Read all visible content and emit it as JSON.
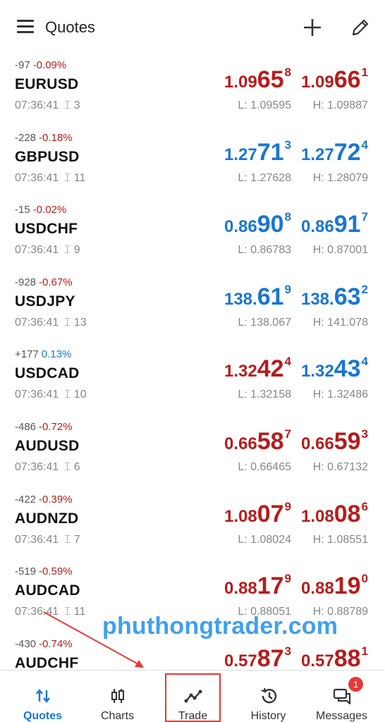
{
  "header": {
    "title": "Quotes",
    "menu_icon": "menu-icon",
    "add_icon": "plus-icon",
    "edit_icon": "pencil-icon"
  },
  "colors": {
    "down": "#b71c1c",
    "up": "#1976d2",
    "watermark": "#3fa0ef",
    "badge": "#e53935"
  },
  "quotes": [
    {
      "symbol": "EURUSD",
      "change_pts": "-97",
      "change_pct": "-0.09%",
      "change_dir": "neg",
      "time": "07:36:41",
      "spread": "3",
      "bid": {
        "small": "1.09",
        "big": "65",
        "sup": "8",
        "dir": "down"
      },
      "ask": {
        "small": "1.09",
        "big": "66",
        "sup": "1",
        "dir": "down"
      },
      "low": "L: 1.09595",
      "high": "H: 1.09887"
    },
    {
      "symbol": "GBPUSD",
      "change_pts": "-228",
      "change_pct": "-0.18%",
      "change_dir": "neg",
      "time": "07:36:41",
      "spread": "11",
      "bid": {
        "small": "1.27",
        "big": "71",
        "sup": "3",
        "dir": "up"
      },
      "ask": {
        "small": "1.27",
        "big": "72",
        "sup": "4",
        "dir": "up"
      },
      "low": "L: 1.27628",
      "high": "H: 1.28079"
    },
    {
      "symbol": "USDCHF",
      "change_pts": "-15",
      "change_pct": "-0.02%",
      "change_dir": "neg",
      "time": "07:36:41",
      "spread": "9",
      "bid": {
        "small": "0.86",
        "big": "90",
        "sup": "8",
        "dir": "up"
      },
      "ask": {
        "small": "0.86",
        "big": "91",
        "sup": "7",
        "dir": "up"
      },
      "low": "L: 0.86783",
      "high": "H: 0.87001"
    },
    {
      "symbol": "USDJPY",
      "change_pts": "-928",
      "change_pct": "-0.67%",
      "change_dir": "neg",
      "time": "07:36:41",
      "spread": "13",
      "bid": {
        "small": "138.",
        "big": "61",
        "sup": "9",
        "dir": "up"
      },
      "ask": {
        "small": "138.",
        "big": "63",
        "sup": "2",
        "dir": "up"
      },
      "low": "L: 138.067",
      "high": "H: 141.078"
    },
    {
      "symbol": "USDCAD",
      "change_pts": "+177",
      "change_pct": "0.13%",
      "change_dir": "pos",
      "time": "07:36:41",
      "spread": "10",
      "bid": {
        "small": "1.32",
        "big": "42",
        "sup": "4",
        "dir": "down"
      },
      "ask": {
        "small": "1.32",
        "big": "43",
        "sup": "4",
        "dir": "up"
      },
      "low": "L: 1.32158",
      "high": "H: 1.32486"
    },
    {
      "symbol": "AUDUSD",
      "change_pts": "-486",
      "change_pct": "-0.72%",
      "change_dir": "neg",
      "time": "07:36:41",
      "spread": "6",
      "bid": {
        "small": "0.66",
        "big": "58",
        "sup": "7",
        "dir": "down"
      },
      "ask": {
        "small": "0.66",
        "big": "59",
        "sup": "3",
        "dir": "down"
      },
      "low": "L: 0.66465",
      "high": "H: 0.67132"
    },
    {
      "symbol": "AUDNZD",
      "change_pts": "-422",
      "change_pct": "-0.39%",
      "change_dir": "neg",
      "time": "07:36:41",
      "spread": "7",
      "bid": {
        "small": "1.08",
        "big": "07",
        "sup": "9",
        "dir": "down"
      },
      "ask": {
        "small": "1.08",
        "big": "08",
        "sup": "6",
        "dir": "down"
      },
      "low": "L: 1.08024",
      "high": "H: 1.08551"
    },
    {
      "symbol": "AUDCAD",
      "change_pts": "-519",
      "change_pct": "-0.59%",
      "change_dir": "neg",
      "time": "07:36:41",
      "spread": "11",
      "bid": {
        "small": "0.88",
        "big": "17",
        "sup": "9",
        "dir": "down"
      },
      "ask": {
        "small": "0.88",
        "big": "19",
        "sup": "0",
        "dir": "down"
      },
      "low": "L: 0.88051",
      "high": "H: 0.88789"
    },
    {
      "symbol": "AUDCHF",
      "change_pts": "-430",
      "change_pct": "-0.74%",
      "change_dir": "neg",
      "time": "",
      "spread": "",
      "bid": {
        "small": "0.57",
        "big": "87",
        "sup": "3",
        "dir": "down"
      },
      "ask": {
        "small": "0.57",
        "big": "88",
        "sup": "1",
        "dir": "down"
      },
      "low": "",
      "high": ""
    }
  ],
  "watermark": "phuthongtrader.com",
  "nav": {
    "tabs": [
      {
        "label": "Quotes",
        "icon": "sort-arrows-icon",
        "active": true
      },
      {
        "label": "Charts",
        "icon": "candlestick-icon",
        "active": false
      },
      {
        "label": "Trade",
        "icon": "trend-line-icon",
        "active": false
      },
      {
        "label": "History",
        "icon": "history-icon",
        "active": false
      },
      {
        "label": "Messages",
        "icon": "chat-icon",
        "active": false
      }
    ],
    "messages_badge": "1"
  }
}
